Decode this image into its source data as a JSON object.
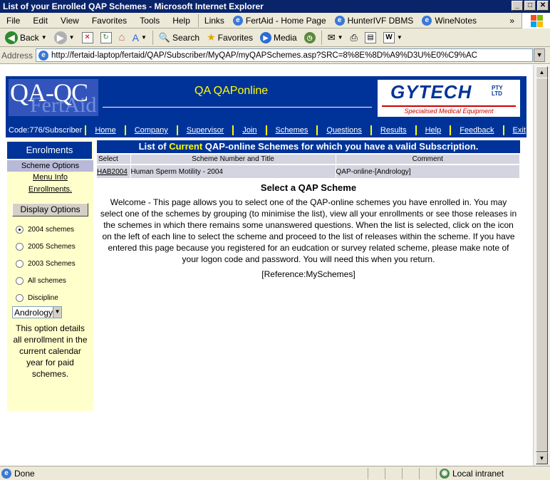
{
  "window": {
    "title": "List of your Enrolled QAP Schemes - Microsoft Internet Explorer"
  },
  "menu": [
    "File",
    "Edit",
    "View",
    "Favorites",
    "Tools",
    "Help"
  ],
  "links": {
    "label": "Links",
    "items": [
      "FertAid - Home Page",
      "HunterIVF DBMS",
      "WineNotes"
    ],
    "more": "»"
  },
  "toolbar": {
    "back": "Back",
    "search": "Search",
    "favorites": "Favorites",
    "media": "Media"
  },
  "address": {
    "label": "Address",
    "url": "http://fertaid-laptop/fertaid/QAP/Subscriber/MyQAP/myQAPSchemes.asp?SRC=8%8E%8D%A9%D3U%E0%C9%AC"
  },
  "header": {
    "logo_main": "QA-QC",
    "logo_sub": "FertAid",
    "site_title": "QA QAPonline",
    "brand": "GYTECH",
    "brand_suffix_1": "PTY",
    "brand_suffix_2": "LTD",
    "brand_tagline": "Specialised Medical Equipment"
  },
  "nav": {
    "code": "Code:776/Subscriber",
    "items": [
      "Home",
      "Company",
      "Supervisor",
      "Join",
      "Schemes",
      "Questions",
      "Results",
      "Help",
      "Feedback",
      "Exit"
    ]
  },
  "sidebar": {
    "heading": "Enrolments",
    "options_heading": "Scheme Options",
    "links": [
      "Menu Info",
      "Enrollments."
    ],
    "display_button": "Display Options",
    "radios": [
      {
        "label": "2004 schemes",
        "checked": true
      },
      {
        "label": "2005 Schemes",
        "checked": false
      },
      {
        "label": "2003 Schemes",
        "checked": false
      },
      {
        "label": "All schemes",
        "checked": false
      },
      {
        "label": "Discipline",
        "checked": false
      }
    ],
    "discipline_value": "Andrology",
    "note": "This option details all enrollment in the current calendar year for paid schemes."
  },
  "main": {
    "heading_pre": "List of ",
    "heading_current": "Current",
    "heading_post": " QAP-online Schemes for which you have a valid Subscription.",
    "columns": [
      "Select",
      "Scheme Number and Title",
      "Comment"
    ],
    "rows": [
      {
        "select": "HAB2004",
        "title": "Human Sperm Motility - 2004",
        "comment": "QAP-online-[Andrology]"
      }
    ],
    "section_title": "Select a QAP Scheme",
    "welcome": "Welcome - This page allows you to select one of the QAP-online schemes you have enrolled in. You may select one of the schemes by grouping (to minimise the list), view all your enrollments or see those releases in the schemes in which there remains some unanswered questions. When the list is selected, click on the icon on the left of each line to select the scheme and proceed to the list of releases within the scheme. If you have entered this page because you registered for an eudcation or survey related scheme, please make note of your logon code and password. You will need this when you return.",
    "reference": "[Reference:MySchemes]"
  },
  "status": {
    "text": "Done",
    "zone": "Local intranet"
  }
}
